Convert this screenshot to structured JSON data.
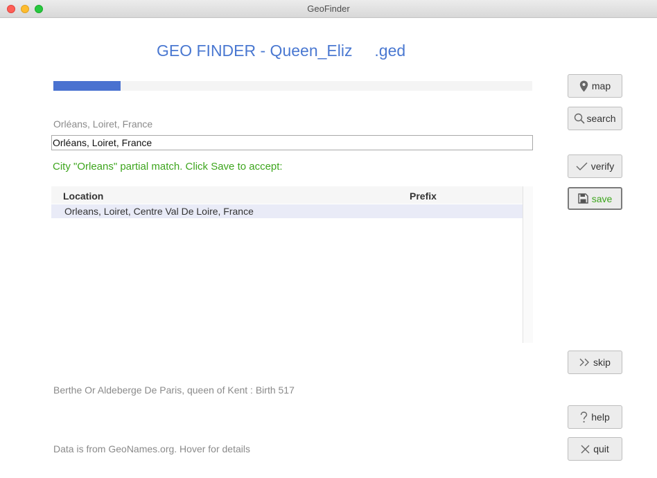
{
  "window": {
    "title": "GeoFinder"
  },
  "header": {
    "app_title": "GEO FINDER - Queen_Eliz     .ged"
  },
  "progress": {
    "fraction": 0.14
  },
  "place": {
    "original": "Orléans, Loiret, France",
    "input_value": "Orléans, Loiret, France"
  },
  "status": {
    "message": "City \"Orleans\" partial match.  Click Save to accept:",
    "color": "#3da51d"
  },
  "results": {
    "columns": {
      "location": "Location",
      "prefix": "Prefix"
    },
    "rows": [
      {
        "location": "Orleans, Loiret, Centre Val De Loire, France",
        "prefix": ""
      }
    ]
  },
  "buttons": {
    "map": {
      "label": "map",
      "icon": "map-pin-icon"
    },
    "search": {
      "label": "search",
      "icon": "magnifier-icon"
    },
    "verify": {
      "label": "verify",
      "icon": "checkmark-icon"
    },
    "save": {
      "label": "save",
      "icon": "floppy-disk-icon"
    },
    "skip": {
      "label": "skip",
      "icon": "double-chevron-right-icon"
    },
    "help": {
      "label": "help",
      "icon": "question-mark-icon"
    },
    "quit": {
      "label": "quit",
      "icon": "x-icon"
    }
  },
  "footer": {
    "person": "Berthe Or Aldeberge De Paris, queen of Kent : Birth 517",
    "credit": "Data is from GeoNames.org.  Hover for details"
  },
  "colors": {
    "accent": "#4a78d1",
    "progress": "#4a72d0",
    "success": "#3da51d"
  }
}
